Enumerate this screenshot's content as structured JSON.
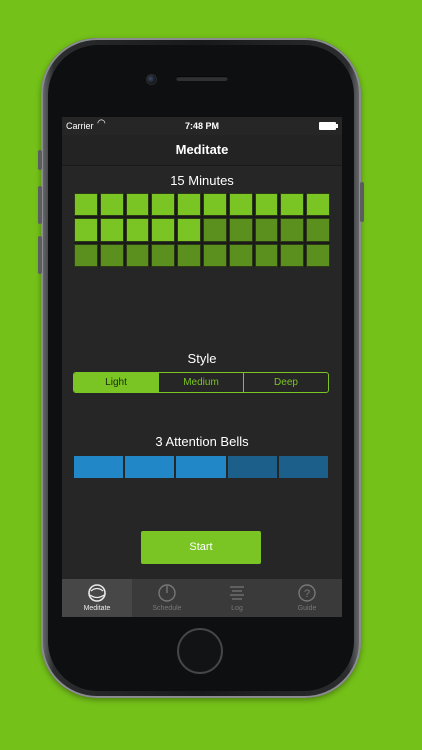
{
  "status": {
    "carrier": "Carrier",
    "time": "7:48 PM"
  },
  "nav": {
    "title": "Meditate"
  },
  "duration": {
    "title": "15 Minutes",
    "selected_blocks": 15,
    "total_blocks": 30
  },
  "style": {
    "title": "Style",
    "options": [
      "Light",
      "Medium",
      "Deep"
    ],
    "selected": "Light"
  },
  "bells": {
    "title": "3 Attention Bells",
    "selected_count": 3,
    "total": 5
  },
  "start_label": "Start",
  "tabs": [
    {
      "label": "Meditate",
      "icon": "meditate-icon",
      "active": true
    },
    {
      "label": "Schedule",
      "icon": "schedule-icon",
      "active": false
    },
    {
      "label": "Log",
      "icon": "log-icon",
      "active": false
    },
    {
      "label": "Guide",
      "icon": "guide-icon",
      "active": false
    }
  ],
  "colors": {
    "accent": "#7ac524",
    "bell": "#2287c7",
    "background": "#74c119"
  }
}
